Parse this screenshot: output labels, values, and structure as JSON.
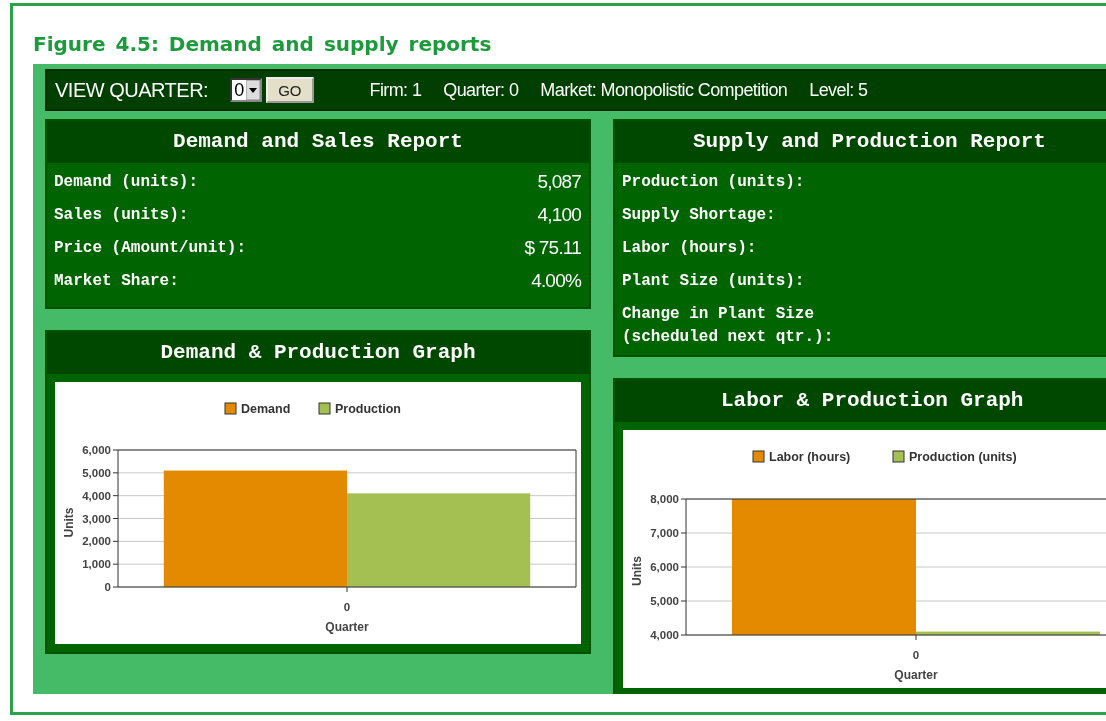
{
  "figure": {
    "caption": "Figure 4.5: Demand and supply reports"
  },
  "toolbar": {
    "label": "VIEW QUARTER:",
    "quarter_select": {
      "value": "0"
    },
    "go_button": "GO",
    "info": [
      "Firm: 1",
      "Quarter: 0",
      "Market: Monopolistic Competition",
      "Level: 5"
    ]
  },
  "demand_report": {
    "title": "Demand and Sales Report",
    "rows": [
      {
        "label": "Demand (units):",
        "value": "5,087"
      },
      {
        "label": "Sales (units):",
        "value": "4,100"
      },
      {
        "label": "Price (Amount/unit):",
        "value": "$ 75.11"
      },
      {
        "label": "Market Share:",
        "value": "4.00%"
      }
    ]
  },
  "demand_graph": {
    "title": "Demand & Production Graph",
    "chart_data": {
      "type": "bar",
      "xlabel": "Quarter",
      "ylabel": "Units",
      "categories": [
        "0"
      ],
      "grid": true,
      "legend": true,
      "series": [
        {
          "name": "Demand",
          "color": "#e38a00",
          "values": [
            5100
          ]
        },
        {
          "name": "Production",
          "color": "#a4bf52",
          "values": [
            4100
          ]
        }
      ],
      "ylim": [
        0,
        6000
      ],
      "yticks": [
        {
          "value": 0,
          "label": "0"
        },
        {
          "value": 1000,
          "label": "1,000"
        },
        {
          "value": 2000,
          "label": "2,000"
        },
        {
          "value": 3000,
          "label": "3,000"
        },
        {
          "value": 4000,
          "label": "4,000"
        },
        {
          "value": 5000,
          "label": "5,000"
        },
        {
          "value": 6000,
          "label": "6,000"
        }
      ]
    }
  },
  "supply_report": {
    "title": "Supply and Production Report",
    "rows": [
      {
        "label": "Production (units):"
      },
      {
        "label": "Supply Shortage:"
      },
      {
        "label": "Labor (hours):"
      },
      {
        "label": "Plant Size (units):"
      },
      {
        "label": "Change in Plant Size\n(scheduled next qtr.):"
      }
    ]
  },
  "labor_graph": {
    "title": "Labor & Production Graph",
    "chart_data": {
      "type": "bar",
      "xlabel": "Quarter",
      "ylabel": "Units",
      "categories": [
        "0"
      ],
      "grid": true,
      "legend": true,
      "series": [
        {
          "name": "Labor (hours)",
          "color": "#e38a00",
          "values": [
            8000
          ]
        },
        {
          "name": "Production (units)",
          "color": "#a4bf52",
          "values": [
            4100
          ]
        }
      ],
      "ylim": [
        4000,
        8000
      ],
      "yticks": [
        {
          "value": 4000,
          "label": "4,000"
        },
        {
          "value": 5000,
          "label": "5,000"
        },
        {
          "value": 6000,
          "label": "6,000"
        },
        {
          "value": 7000,
          "label": "7,000"
        },
        {
          "value": 8000,
          "label": "8,000"
        }
      ]
    }
  }
}
